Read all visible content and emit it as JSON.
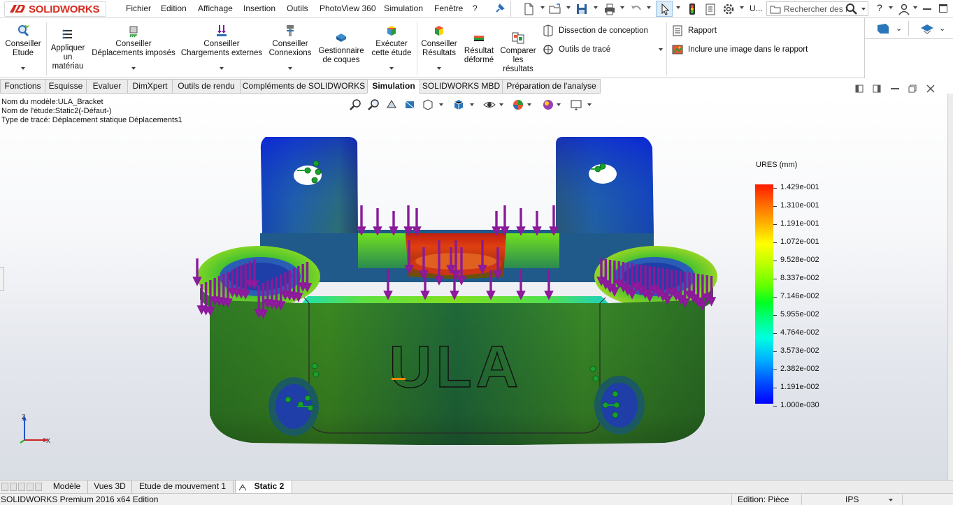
{
  "app": {
    "brand": "SOLIDWORKS",
    "brand_color": "#d52b1e"
  },
  "menu": [
    "Fichier",
    "Edition",
    "Affichage",
    "Insertion",
    "Outils",
    "PhotoView 360",
    "Simulation",
    "Fenêtre",
    "?"
  ],
  "toolbar": {
    "search_placeholder": "Rechercher des f",
    "user_short": "U..."
  },
  "ribbon": {
    "buttons": [
      {
        "id": "conseiller-etude",
        "label": "Conseiller Etude"
      },
      {
        "id": "appliquer-materiau",
        "label": "Appliquer un matériau"
      },
      {
        "id": "conseiller-deplacements",
        "label": "Conseiller Déplacements imposés"
      },
      {
        "id": "conseiller-chargements",
        "label": "Conseiller Chargements externes"
      },
      {
        "id": "conseiller-connexions",
        "label": "Conseiller Connexions"
      },
      {
        "id": "gestionnaire-coques",
        "label": "Gestionnaire de coques"
      },
      {
        "id": "executer-etude",
        "label": "Exécuter cette étude"
      },
      {
        "id": "conseiller-resultats",
        "label": "Conseiller Résultats"
      },
      {
        "id": "resultat-deforme",
        "label": "Résultat déformé"
      },
      {
        "id": "comparer-resultats",
        "label": "Comparer les résultats"
      }
    ],
    "small": {
      "dissection": "Dissection de conception",
      "outils_trace": "Outils de tracé",
      "rapport": "Rapport",
      "inclure_image": "Inclure une image dans le rapport"
    }
  },
  "command_tabs": [
    {
      "label": "Fonctions",
      "active": false
    },
    {
      "label": "Esquisse",
      "active": false
    },
    {
      "label": "Evaluer",
      "active": false
    },
    {
      "label": "DimXpert",
      "active": false
    },
    {
      "label": "Outils de rendu",
      "active": false
    },
    {
      "label": "Compléments de SOLIDWORKS",
      "active": false
    },
    {
      "label": "Simulation",
      "active": true
    },
    {
      "label": "SOLIDWORKS MBD",
      "active": false
    },
    {
      "label": "Préparation de l'analyse",
      "active": false
    }
  ],
  "viewport_info": {
    "model_name": "Nom du modèle:ULA_Bracket",
    "study_name": "Nom de l'étude:Static2(-Défaut-)",
    "plot_type": "Type de tracé: Déplacement statique Déplacements1"
  },
  "model": {
    "engraving": "ULA"
  },
  "legend": {
    "title": "URES (mm)",
    "values": [
      "1.429e-001",
      "1.310e-001",
      "1.191e-001",
      "1.072e-001",
      "9.528e-002",
      "8.337e-002",
      "7.146e-002",
      "5.955e-002",
      "4.764e-002",
      "3.573e-002",
      "2.382e-002",
      "1.191e-002",
      "1.000e-030"
    ]
  },
  "triad": {
    "z": "Z",
    "x": "X"
  },
  "bottom_tabs": [
    {
      "label": "Modèle",
      "active": false
    },
    {
      "label": "Vues 3D",
      "active": false
    },
    {
      "label": "Etude de mouvement 1",
      "active": false
    },
    {
      "label": "Static 2",
      "active": true
    }
  ],
  "status": {
    "product": "SOLIDWORKS Premium 2016 x64 Edition",
    "edition": "Edition: Pièce",
    "units": "IPS"
  }
}
